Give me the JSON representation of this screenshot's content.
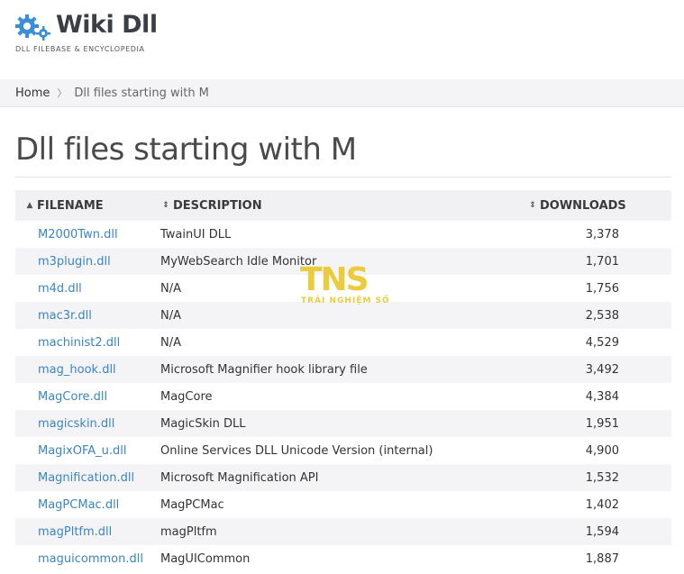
{
  "brand": {
    "name": "Wiki Dll",
    "tagline": "DLL FILEBASE & ENCYCLOPEDIA",
    "gear_color": "#3a8fd6"
  },
  "breadcrumb": {
    "home": "Home",
    "separator": "〉",
    "current": "Dll files starting with M"
  },
  "page": {
    "title": "Dll files starting with M"
  },
  "table": {
    "headers": {
      "filename": "FILENAME",
      "description": "DESCRIPTION",
      "downloads": "DOWNLOADS"
    },
    "rows": [
      {
        "filename": "M2000Twn.dll",
        "description": "TwainUI DLL",
        "downloads": "3,378"
      },
      {
        "filename": "m3plugin.dll",
        "description": "MyWebSearch Idle Monitor",
        "downloads": "1,701"
      },
      {
        "filename": "m4d.dll",
        "description": "N/A",
        "downloads": "1,756"
      },
      {
        "filename": "mac3r.dll",
        "description": "N/A",
        "downloads": "2,538"
      },
      {
        "filename": "machinist2.dll",
        "description": "N/A",
        "downloads": "4,529"
      },
      {
        "filename": "mag_hook.dll",
        "description": "Microsoft Magnifier hook library file",
        "downloads": "3,492"
      },
      {
        "filename": "MagCore.dll",
        "description": "MagCore",
        "downloads": "4,384"
      },
      {
        "filename": "magicskin.dll",
        "description": "MagicSkin DLL",
        "downloads": "1,951"
      },
      {
        "filename": "MagixOFA_u.dll",
        "description": "Online Services DLL Unicode Version (internal)",
        "downloads": "4,900"
      },
      {
        "filename": "Magnification.dll",
        "description": "Microsoft Magnification API",
        "downloads": "1,532"
      },
      {
        "filename": "MagPCMac.dll",
        "description": "MagPCMac",
        "downloads": "1,402"
      },
      {
        "filename": "magPltfm.dll",
        "description": "magPltfm",
        "downloads": "1,594"
      },
      {
        "filename": "maguicommon.dll",
        "description": "MagUICommon",
        "downloads": "1,887"
      }
    ]
  },
  "watermark": {
    "logo": "TNS",
    "tagline": "TRẢI NGHIỆM SỐ",
    "color": "#e9c72a"
  }
}
